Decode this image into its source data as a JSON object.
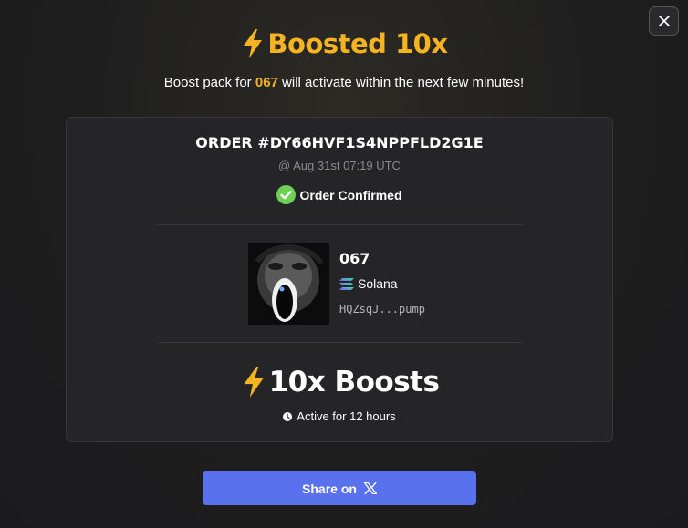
{
  "modal": {
    "close_icon": "close-icon",
    "title": "Boosted 10x",
    "title_icon": "lightning-bolt-icon",
    "subtitle_prefix": "Boost pack for ",
    "subtitle_token": "067",
    "subtitle_suffix": " will activate within the next few minutes!"
  },
  "order": {
    "id_label": "ORDER #DY66HVF1S4NPPFLD2G1E",
    "date": "@ Aug 31st 07:19 UTC",
    "status": "Order Confirmed",
    "status_icon": "check-circle-icon"
  },
  "token": {
    "name": "067",
    "chain": "Solana",
    "chain_icon": "solana-icon",
    "address": "HQZsqJ...pump"
  },
  "boost": {
    "label": "10x Boosts",
    "icon": "lightning-bolt-icon",
    "duration": "Active for 12 hours",
    "duration_icon": "clock-icon"
  },
  "share": {
    "label": "Share on",
    "icon": "x-logo-icon"
  },
  "colors": {
    "accent": "#f4b322",
    "success": "#6fcf57",
    "share_button": "#5a71ee",
    "card_bg": "#252527"
  }
}
